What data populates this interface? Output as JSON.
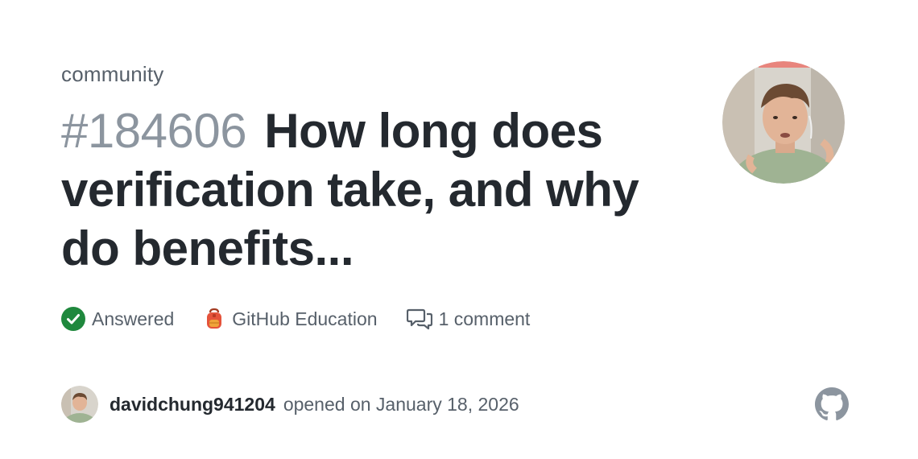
{
  "repo": "community",
  "discussion": {
    "number": "#184606",
    "title": "How long does verification take, and why do benefits..."
  },
  "meta": {
    "status": "Answered",
    "category": "GitHub Education",
    "comments": "1 comment"
  },
  "footer": {
    "author": "davidchung941204",
    "opened": "opened on January 18, 2026"
  },
  "icons": {
    "status": "check-circle-icon",
    "category": "backpack-icon",
    "comments": "comment-discussion-icon",
    "brand": "github-logo-icon"
  },
  "colors": {
    "answered_green": "#1f883d",
    "number_gray": "#8c959f",
    "muted_text": "#57606a",
    "title_text": "#24292f",
    "github_logo": "#8c959f"
  }
}
